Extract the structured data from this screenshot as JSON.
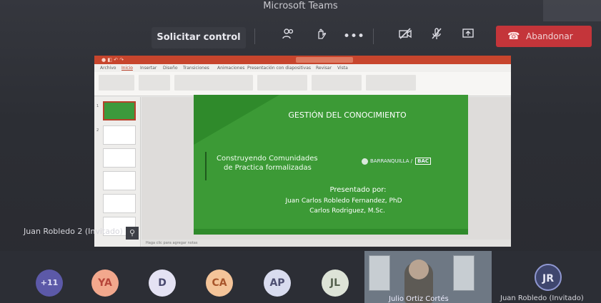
{
  "window": {
    "title": "Microsoft Teams"
  },
  "toolbar": {
    "request_control_label": "Solicitar control",
    "leave_label": "Abandonar"
  },
  "icons": [
    "participants-icon",
    "raise-hand-icon",
    "more-options-icon",
    "camera-off-icon",
    "mic-off-icon",
    "share-icon",
    "phone-hangup-icon"
  ],
  "presenter": {
    "name": "Juan Robledo 2 (Invitado)"
  },
  "powerpoint": {
    "status_text": "Haga clic para agregar notas",
    "tabs": [
      "Archivo",
      "Inicio",
      "Insertar",
      "Diseño",
      "Transiciones",
      "Animaciones",
      "Presentación con diapositivas",
      "Revisar",
      "Vista"
    ]
  },
  "slide": {
    "title": "GESTIÓN DEL CONOCIMIENTO",
    "subtitle_line1": "Construyendo Comunidades",
    "subtitle_line2": "de Practica formalizadas",
    "logo_text": "BARRANQUILLA",
    "logo_badge": "BAC",
    "presented_by": "Presentado por:",
    "name1": "Juan Carlos Robledo Fernandez, PhD",
    "name2": "Carlos Rodriguez, M.Sc."
  },
  "participants": {
    "more_count": "+11",
    "avatars": [
      "YA",
      "D",
      "CA",
      "AP",
      "JL"
    ],
    "video_name": "Julio Ortiz Cortés",
    "jr_initials": "JR",
    "jr_name": "Juan Robledo (Invitado)"
  }
}
